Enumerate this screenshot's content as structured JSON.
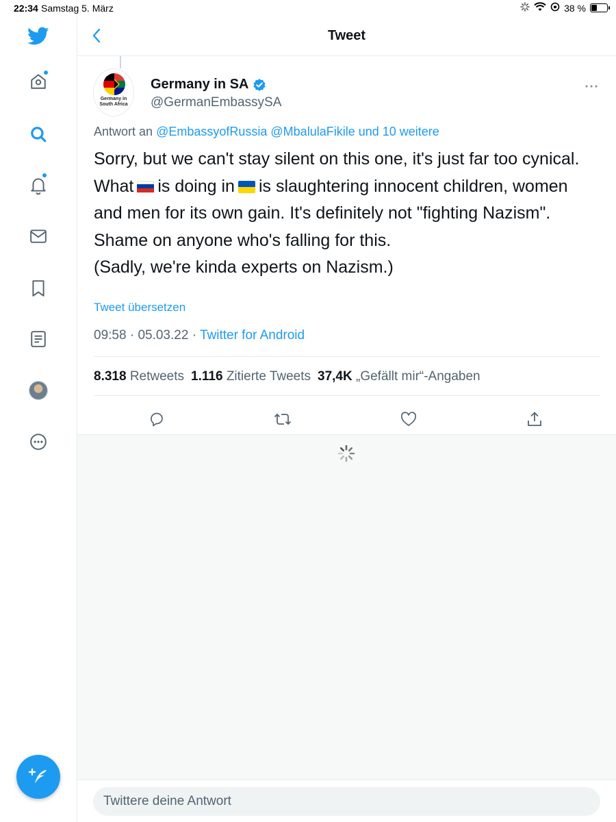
{
  "status_bar": {
    "time": "22:34",
    "date": "Samstag 5. März",
    "battery_percent": "38 %",
    "battery_level": 0.38
  },
  "sidebar": {
    "items": [
      {
        "name": "home-icon",
        "has_dot": true
      },
      {
        "name": "explore-icon",
        "active": true
      },
      {
        "name": "notifications-icon",
        "has_dot": true
      },
      {
        "name": "messages-icon"
      },
      {
        "name": "bookmarks-icon"
      },
      {
        "name": "lists-icon"
      },
      {
        "name": "profile-avatar"
      },
      {
        "name": "more-icon"
      }
    ],
    "compose_icon": "compose-tweet-icon"
  },
  "header": {
    "title": "Tweet",
    "back_icon": "chevron-left-icon"
  },
  "tweet": {
    "author": {
      "name": "Germany in SA",
      "handle": "@GermanEmbassySA",
      "verified": true,
      "avatar_caption": "Germany in South Africa"
    },
    "reply_to": {
      "prefix": "Antwort an",
      "mention_1": "@EmbassyofRussia",
      "mention_2": "@MbalulaFikile",
      "suffix": "und 10 weitere"
    },
    "text": {
      "part1": "Sorry, but we can't stay silent on this one, it's just far too cynical. What",
      "part2": "is doing in",
      "part3": "is slaughtering innocent children, women and men for its own gain. It's definitely not \"fighting Nazism\". Shame on anyone who's falling for this.",
      "part4": "(Sadly, we're kinda experts on Nazism.)"
    },
    "translate_label": "Tweet übersetzen",
    "time": "09:58",
    "date": "05.03.22",
    "separator": "·",
    "source": "Twitter for Android",
    "stats": {
      "retweets_count": "8.318",
      "retweets_label": "Retweets",
      "quotes_count": "1.116",
      "quotes_label": "Zitierte Tweets",
      "likes_count": "37,4K",
      "likes_label": "„Gefällt mir“-Angaben"
    }
  },
  "actions": [
    "reply-icon",
    "retweet-icon",
    "like-icon",
    "share-icon"
  ],
  "reply_bar": {
    "placeholder": "Twittere deine Antwort"
  },
  "colors": {
    "accent": "#1d9bf0",
    "secondary_text": "#536471",
    "border": "#e6ecf0"
  }
}
